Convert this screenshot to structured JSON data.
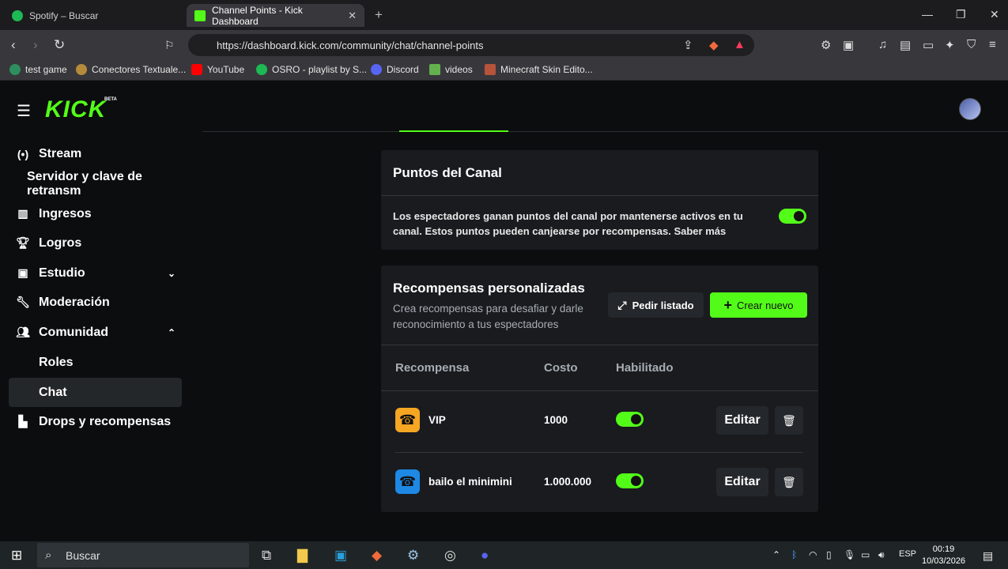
{
  "browser": {
    "tabs": [
      {
        "title": "Spotify – Buscar",
        "active": false,
        "color": "#1db954"
      },
      {
        "title": "Channel Points - Kick Dashboard",
        "active": true,
        "color": "#53fc18"
      }
    ],
    "url": "https://dashboard.kick.com/community/chat/channel-points",
    "bookmarks": [
      {
        "label": "test game",
        "color": "#2d8f5f"
      },
      {
        "label": "Conectores Textuale...",
        "color": "#b58a3a"
      },
      {
        "label": "YouTube",
        "color": "#ff0000"
      },
      {
        "label": "OSRO - playlist by S...",
        "color": "#1db954"
      },
      {
        "label": "Discord",
        "color": "#5865f2"
      },
      {
        "label": "videos",
        "color": "#63b14e"
      },
      {
        "label": "Minecraft Skin Edito...",
        "color": "#b5533b"
      }
    ]
  },
  "header": {
    "logo": "KICK",
    "beta": "BETA"
  },
  "sidebar": {
    "items": [
      {
        "label": "Stream",
        "icon": "broadcast-icon"
      },
      {
        "label": "Servidor y clave de retransm",
        "icon": ""
      },
      {
        "label": "Ingresos",
        "icon": "chart-icon"
      },
      {
        "label": "Logros",
        "icon": "trophy-icon"
      },
      {
        "label": "Estudio",
        "icon": "studio-icon"
      },
      {
        "label": "Moderación",
        "icon": "wrench-icon"
      },
      {
        "label": "Comunidad",
        "icon": "users-icon"
      },
      {
        "label": "Roles",
        "icon": ""
      },
      {
        "label": "Chat",
        "icon": ""
      },
      {
        "label": "Drops y recompensas",
        "icon": "drops-icon"
      }
    ]
  },
  "channel_points": {
    "title": "Puntos del Canal",
    "description": "Los espectadores ganan puntos del canal por mantenerse activos en tu canal. Estos puntos pueden canjearse por recompensas. Saber más",
    "enabled": true
  },
  "rewards": {
    "title": "Recompensas personalizadas",
    "subtitle": "Crea recompensas para desafiar y darle reconocimiento a tus espectadores",
    "list_button": "Pedir listado",
    "create_button": "Crear nuevo",
    "columns": [
      "Recompensa",
      "Costo",
      "Habilitado"
    ],
    "rows": [
      {
        "name": "VIP",
        "cost": "1000",
        "enabled": true,
        "edit": "Editar",
        "color": "#f5a623"
      },
      {
        "name": "bailo el minimini",
        "cost": "1.000.000",
        "enabled": true,
        "edit": "Editar",
        "color": "#1e88e5"
      }
    ]
  },
  "taskbar": {
    "search": "Buscar",
    "lang": "ESP",
    "time": "00:19",
    "date": "10/03/2026"
  },
  "accent": "#53fc18"
}
